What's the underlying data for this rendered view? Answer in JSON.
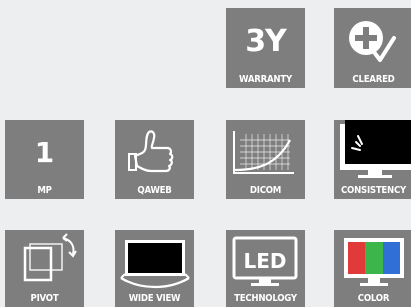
{
  "tiles": {
    "warranty": {
      "big": "3Y",
      "label": "WARRANTY",
      "icon": "warranty-text"
    },
    "cleared": {
      "label": "CLEARED",
      "icon": "medical-cross-check-icon"
    },
    "mp": {
      "big": "1",
      "label": "MP",
      "icon": "megapixel-text"
    },
    "qaweb": {
      "label": "QAWEB",
      "icon": "thumbs-up-icon"
    },
    "dicom": {
      "label": "DICOM",
      "icon": "dicom-curve-icon"
    },
    "consistency": {
      "label": "CONSISTENCY",
      "icon": "monitor-sensor-icon"
    },
    "pivot": {
      "label": "PIVOT",
      "icon": "pivot-rotate-icon"
    },
    "wideview": {
      "label": "WIDE VIEW",
      "icon": "wide-view-monitor-icon"
    },
    "technology": {
      "label": "TECHNOLOGY",
      "icon": "led-monitor-icon"
    },
    "color": {
      "label": "COLOR",
      "icon": "rgb-monitor-icon"
    }
  },
  "colors": {
    "tile_bg": "#7e7e7e",
    "page_bg": "#edeef0",
    "red": "#e03a3a",
    "green": "#3cb54a",
    "blue": "#2f6fd6"
  }
}
